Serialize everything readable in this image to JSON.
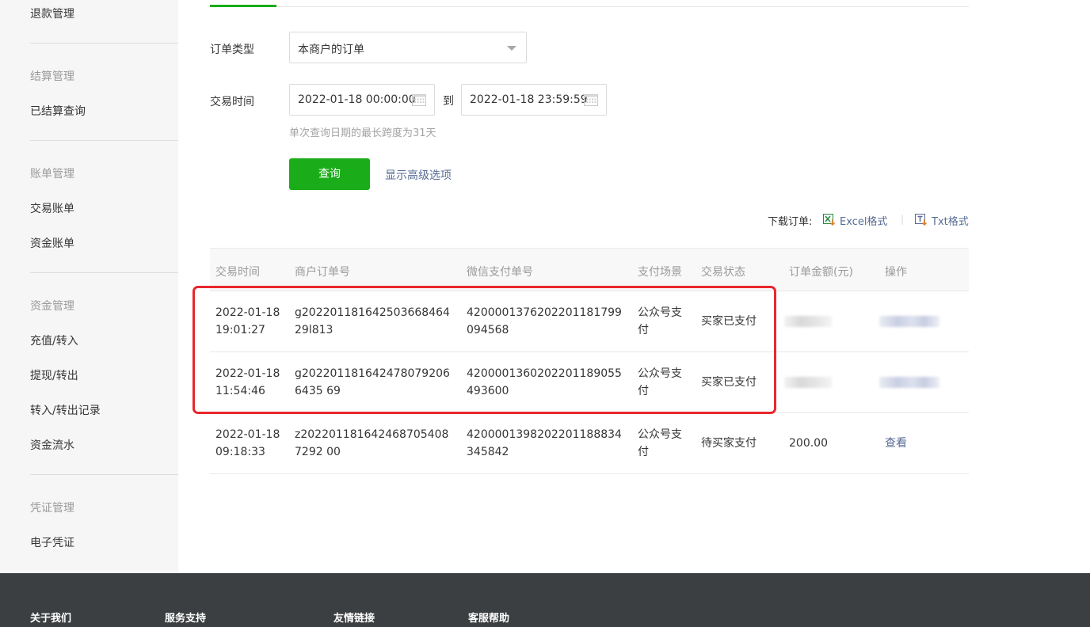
{
  "sidebar": {
    "top_item": "退款管理",
    "groups": [
      {
        "title": "结算管理",
        "items": [
          "已结算查询"
        ]
      },
      {
        "title": "账单管理",
        "items": [
          "交易账单",
          "资金账单"
        ]
      },
      {
        "title": "资金管理",
        "items": [
          "充值/转入",
          "提现/转出",
          "转入/转出记录",
          "资金流水"
        ]
      },
      {
        "title": "凭证管理",
        "items": [
          "电子凭证"
        ]
      }
    ]
  },
  "form": {
    "order_type_label": "订单类型",
    "order_type_value": "本商户的订单",
    "time_label": "交易时间",
    "start_date": "2022-01-18 00:00:00",
    "to_label": "到",
    "end_date": "2022-01-18 23:59:59",
    "hint": "单次查询日期的最长跨度为31天",
    "query_button": "查询",
    "advanced_link": "显示高级选项"
  },
  "download": {
    "label": "下载订单:",
    "excel": "Excel格式",
    "txt": "Txt格式"
  },
  "table": {
    "headers": [
      "交易时间",
      "商户订单号",
      "微信支付单号",
      "支付场景",
      "交易状态",
      "订单金额(元)",
      "操作"
    ],
    "rows": [
      {
        "time": "2022-01-18 19:01:27",
        "merchant_no": "g20220118164250366846429l813",
        "wx_no": "4200001376202201181799094568",
        "scene": "公众号支付",
        "status": "买家已支付",
        "amount": "",
        "action": ""
      },
      {
        "time": "2022-01-18 11:54:46",
        "merchant_no": "g2022011816424780792066435 69",
        "wx_no": "4200001360202201189055493600",
        "scene": "公众号支付",
        "status": "买家已支付",
        "amount": "",
        "action": ""
      },
      {
        "time": "2022-01-18 09:18:33",
        "merchant_no": "z2022011816424687054087292 00",
        "wx_no": "4200001398202201188834345842",
        "scene": "公众号支付",
        "status": "待买家支付",
        "amount": "200.00",
        "action": "查看"
      }
    ]
  },
  "footer": {
    "columns": [
      "关于我们",
      "服务支持",
      "友情链接",
      "客服帮助"
    ]
  },
  "colors": {
    "brand_green": "#1aad19",
    "link_blue": "#576b95",
    "highlight_red": "#e8272d",
    "footer_bg": "#3c3f41"
  }
}
